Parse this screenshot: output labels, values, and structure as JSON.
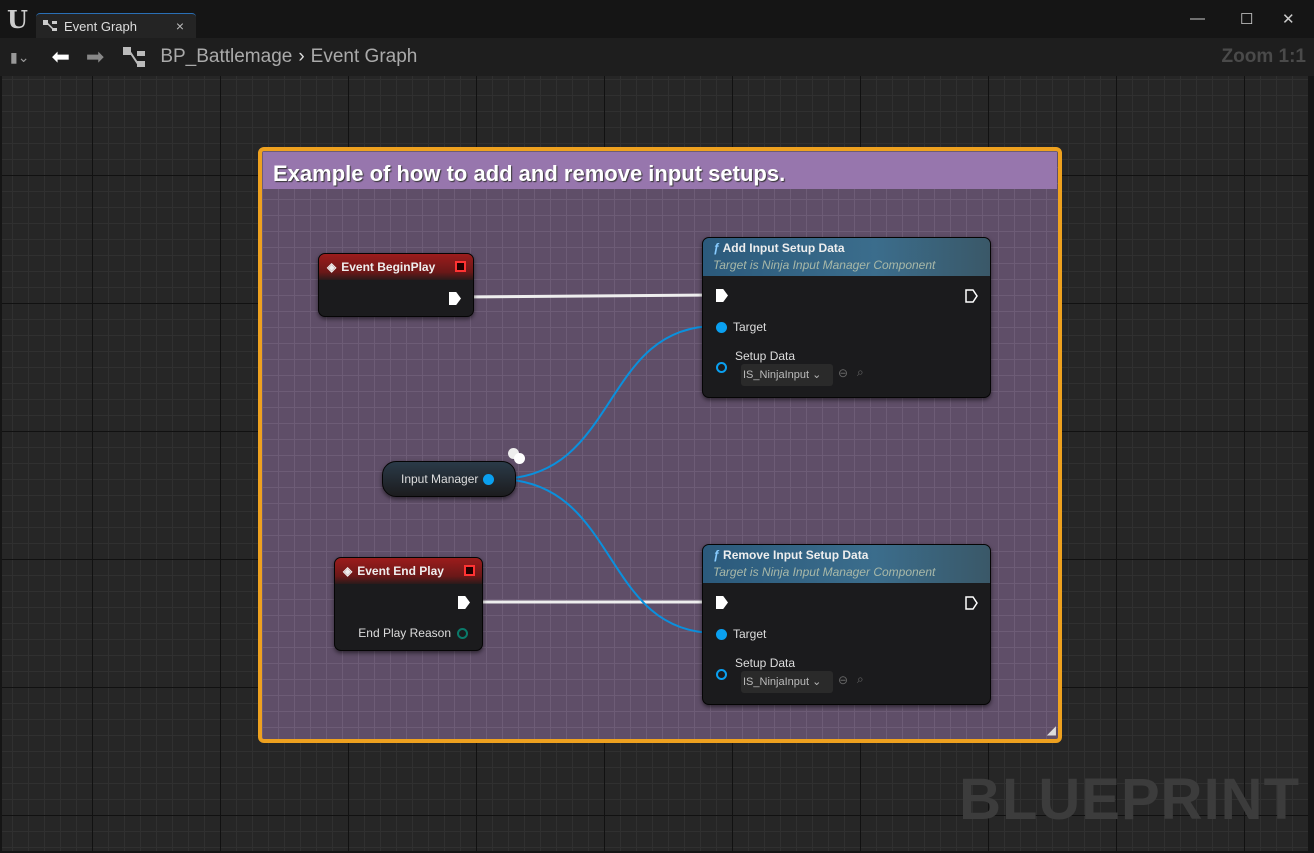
{
  "window": {
    "tab_label": "Event Graph",
    "close": "×",
    "minimize": "—",
    "maximize": "☐",
    "close_window": "✕"
  },
  "toolbar": {
    "breadcrumb": [
      "BP_Battlemage",
      "Event Graph"
    ],
    "separator": "›",
    "zoom": "Zoom 1:1"
  },
  "watermark": "BLUEPRINT",
  "comment": {
    "title": "Example of how to add and remove input setups."
  },
  "nodes": {
    "begin_play": {
      "title": "Event BeginPlay"
    },
    "end_play": {
      "title": "Event End Play",
      "pin": "End Play Reason"
    },
    "input_manager": {
      "label": "Input Manager"
    },
    "add": {
      "title": "Add Input Setup Data",
      "subtitle": "Target is Ninja Input Manager Component",
      "target": "Target",
      "setup": "Setup Data",
      "value": "IS_NinjaInput"
    },
    "remove": {
      "title": "Remove Input Setup Data",
      "subtitle": "Target is Ninja Input Manager Component",
      "target": "Target",
      "setup": "Setup Data",
      "value": "IS_NinjaInput"
    }
  },
  "colors": {
    "comment_border": "#eea11f",
    "comment_header": "#9776ad",
    "object_pin": "#0aa0f0",
    "event_header": "#9c1c1c",
    "function_header": "#2b5a7c"
  }
}
